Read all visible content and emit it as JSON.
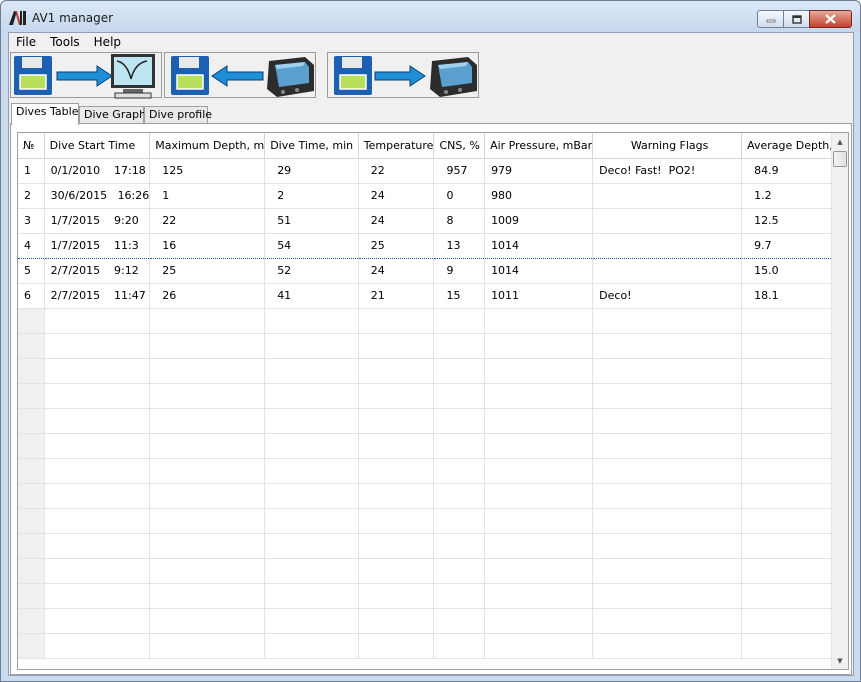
{
  "window": {
    "title": "AV1 manager"
  },
  "menu": [
    "File",
    "Tools",
    "Help"
  ],
  "toolbar": [
    {
      "name": "save-to-graph-button",
      "icons": [
        "floppy-disk-icon",
        "arrow-right-icon",
        "monitor-graph-icon"
      ]
    },
    {
      "name": "download-from-device-button",
      "icons": [
        "floppy-disk-icon",
        "arrow-left-icon",
        "dive-computer-icon"
      ]
    },
    {
      "name": "upload-to-device-button",
      "icons": [
        "floppy-disk-icon",
        "arrow-right-icon",
        "dive-computer-icon"
      ]
    }
  ],
  "tabs": [
    {
      "label": "Dives Table",
      "active": true
    },
    {
      "label": "Dive Graph",
      "active": false
    },
    {
      "label": "Dive profile",
      "active": false
    }
  ],
  "table": {
    "columns": [
      "№",
      "Dive Start Time",
      "Maximum Depth, m",
      "Dive Time, min",
      "Temperature",
      "CNS, %",
      "Air Pressure, mBar",
      "Warning Flags",
      "Average Depth, m"
    ],
    "rows": [
      [
        "1",
        "0/1/2010    17:18",
        "125",
        "29",
        "22",
        "957",
        "979",
        "Deco! Fast!  PO2!",
        "84.9"
      ],
      [
        "2",
        "30/6/2015   16:26",
        "1",
        "2",
        "24",
        "0",
        "980",
        "",
        "1.2"
      ],
      [
        "3",
        "1/7/2015    9:20",
        "22",
        "51",
        "24",
        "8",
        "1009",
        "",
        "12.5"
      ],
      [
        "4",
        "1/7/2015    11:3",
        "16",
        "54",
        "25",
        "13",
        "1014",
        "",
        "9.7"
      ],
      [
        "5",
        "2/7/2015    9:12",
        "25",
        "52",
        "24",
        "9",
        "1014",
        "",
        "15.0"
      ],
      [
        "6",
        "2/7/2015    11:47",
        "26",
        "41",
        "21",
        "15",
        "1011",
        "Deco!",
        "18.1"
      ]
    ],
    "selected_row": 4,
    "empty_rows": 14
  },
  "colors": {
    "accent": "#1e8fd6",
    "selection": "#1e5fb4",
    "floppy": "#1d5fb0"
  }
}
